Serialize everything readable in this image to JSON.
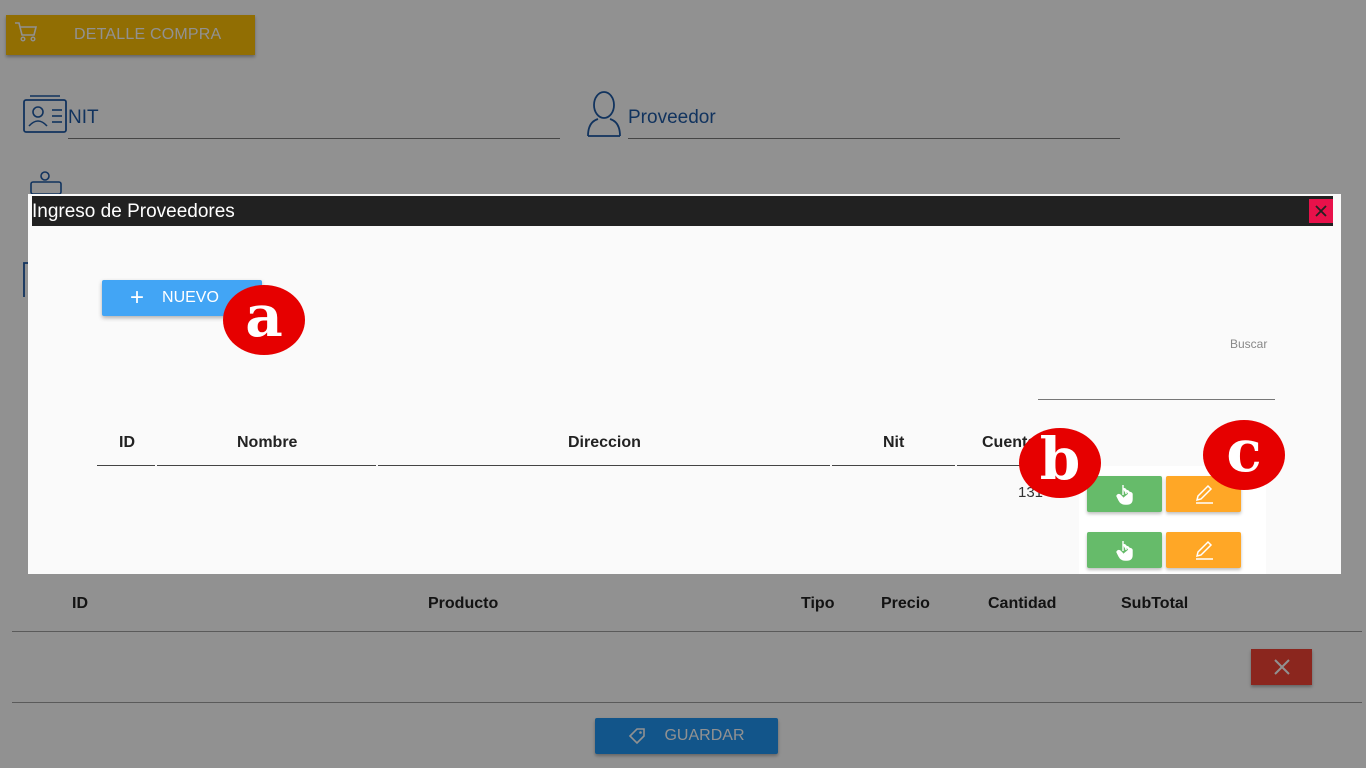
{
  "background": {
    "detalle_button": "DETALLE COMPRA",
    "fields": {
      "nit_label": "NIT",
      "proveedor_label": "Proveedor"
    },
    "table_headers": [
      "ID",
      "Producto",
      "Tipo",
      "Precio",
      "Cantidad",
      "SubTotal"
    ],
    "delete_icon": "close-icon",
    "guardar_label": "GUARDAR"
  },
  "modal": {
    "title": "Ingreso de Proveedores",
    "close_icon": "close-icon",
    "nuevo_label": "NUEVO",
    "search": {
      "label": "Buscar",
      "value": ""
    },
    "table": {
      "headers": [
        "ID",
        "Nombre",
        "Direccion",
        "Nit",
        "Cuenta"
      ],
      "rows": [
        {
          "cuenta_partial": "131"
        }
      ]
    }
  },
  "badges": {
    "a": "a",
    "b": "b",
    "c": "c"
  },
  "colors": {
    "primary": "#2196f3",
    "warning": "#ffc107",
    "danger": "#f44336",
    "success": "#66bb6a",
    "orange": "#ffa726",
    "title_bar": "#212121",
    "badge": "#e60000"
  }
}
